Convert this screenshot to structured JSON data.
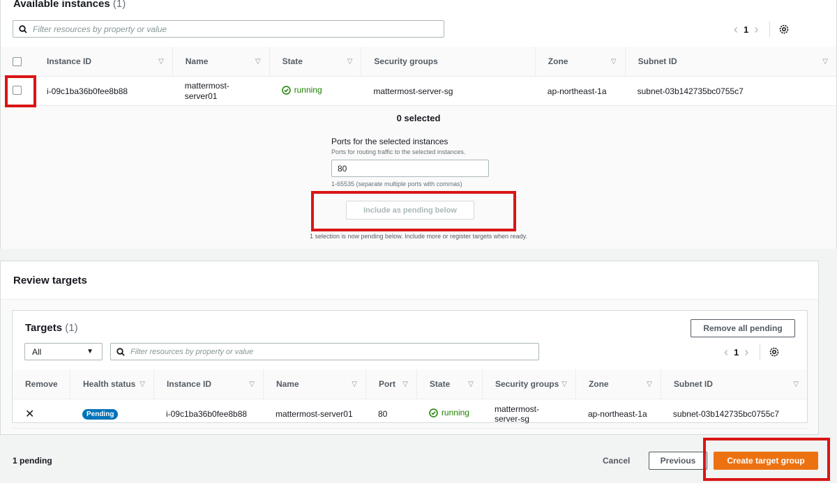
{
  "available": {
    "title": "Available instances",
    "count": "(1)",
    "search_placeholder": "Filter resources by property or value",
    "page": "1",
    "columns": [
      "Instance ID",
      "Name",
      "State",
      "Security groups",
      "Zone",
      "Subnet ID"
    ],
    "rows": [
      {
        "instance_id": "i-09c1ba36b0fee8b88",
        "name_line1": "mattermost-",
        "name_line2": "server01",
        "state": "running",
        "security_group": "mattermost-server-sg",
        "zone": "ap-northeast-1a",
        "subnet": "subnet-03b142735bc0755c7"
      }
    ],
    "selected_text": "0 selected",
    "ports_label": "Ports for the selected instances",
    "ports_desc": "Ports for routing traffic to the selected instances.",
    "ports_value": "80",
    "ports_hint": "1-65535 (separate multiple ports with commas)",
    "include_button": "Include as pending below",
    "pending_note": "1 selection is now pending below. Include more or register targets when ready."
  },
  "review": {
    "title": "Review targets",
    "targets_title": "Targets",
    "targets_count": "(1)",
    "remove_all_button": "Remove all pending",
    "filter_select": "All",
    "search_placeholder": "Filter resources by property or value",
    "page": "1",
    "columns": [
      "Remove",
      "Health status",
      "Instance ID",
      "Name",
      "Port",
      "State",
      "Security groups",
      "Zone",
      "Subnet ID"
    ],
    "rows": [
      {
        "health": "Pending",
        "instance_id": "i-09c1ba36b0fee8b88",
        "name": "mattermost-server01",
        "port": "80",
        "state": "running",
        "security_group": "mattermost-server-sg",
        "zone": "ap-northeast-1a",
        "subnet": "subnet-03b142735bc0755c7"
      }
    ]
  },
  "footer": {
    "pending": "1 pending",
    "cancel": "Cancel",
    "previous": "Previous",
    "create": "Create target group"
  },
  "colors": {
    "primary": "#ec7211",
    "running": "#1d8102",
    "badge": "#0073bb",
    "highlight": "#d91515"
  },
  "icons": [
    "search-icon",
    "gear-icon",
    "chevron-left-icon",
    "chevron-right-icon",
    "sort-icon",
    "check-circle-icon",
    "caret-down-icon",
    "close-icon"
  ]
}
